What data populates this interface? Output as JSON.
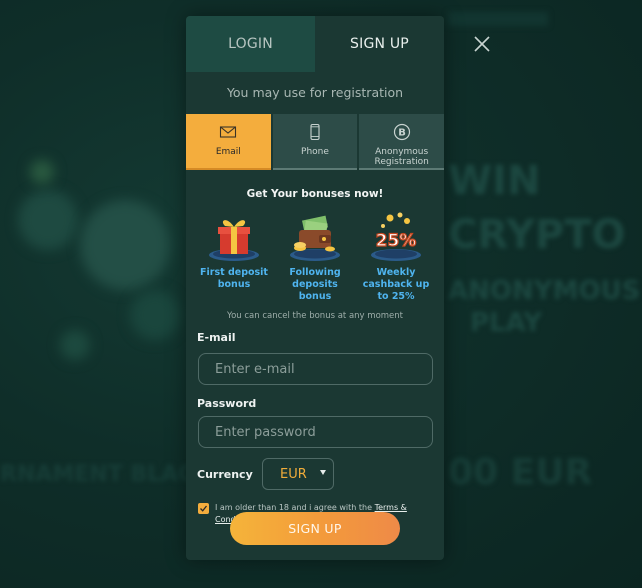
{
  "tabs": {
    "login": "LOGIN",
    "signup": "SIGN UP"
  },
  "registration_hint": "You may use for registration",
  "methods": [
    {
      "label": "Email",
      "icon": "envelope-icon",
      "active": true
    },
    {
      "label": "Phone",
      "icon": "phone-icon",
      "active": false
    },
    {
      "label": "Anonymous Registration",
      "icon": "bitcoin-icon",
      "active": false
    }
  ],
  "bonuses": {
    "title": "Get Your bonuses now!",
    "items": [
      {
        "label": "First deposit bonus",
        "icon": "gift-box-icon"
      },
      {
        "label": "Following deposits bonus",
        "icon": "wallet-coins-icon"
      },
      {
        "label": "Weekly cashback up to 25%",
        "icon": "cashback-25-icon",
        "badge": "25%"
      }
    ],
    "cancel_note": "You can cancel the bonus at any moment"
  },
  "form": {
    "email_label": "E-mail",
    "email_placeholder": "Enter e-mail",
    "password_label": "Password",
    "password_placeholder": "Enter password",
    "currency_label": "Currency",
    "currency_value": "EUR",
    "agree_text": "I am older than 18 and i agree with the ",
    "terms_link": "Terms & Conditions",
    "agree_checked": true,
    "submit_label": "SIGN UP"
  },
  "background": {
    "win": "WIN",
    "crypto": "CRYPTO",
    "anonymous": "ANONYMOUS",
    "play": "PLAY",
    "tournament": "RNAMENT BLAC",
    "amount": "00 EUR"
  },
  "colors": {
    "accent": "#f4ad3d",
    "link_blue": "#4fb4ef",
    "modal_bg": "#1b3833",
    "page_bg": "#0d2a25"
  }
}
